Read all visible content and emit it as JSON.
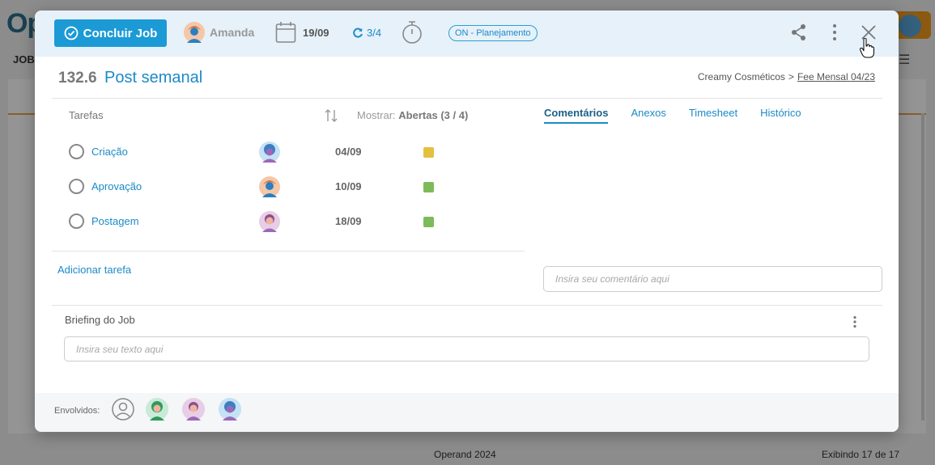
{
  "background": {
    "logo": "Op",
    "jobs_label": "JOBS",
    "footer_left": "Operand 2024",
    "footer_right": "Exibindo 17 de 17"
  },
  "header": {
    "conclude_label": "Concluir Job",
    "owner_name": "Amanda",
    "due_date": "19/09",
    "recurrence": "3/4",
    "status": "ON - Planejamento"
  },
  "job": {
    "id": "132.6",
    "title": "Post semanal",
    "client": "Creamy Cosméticos",
    "separator": ">",
    "contract": "Fee Mensal 04/23"
  },
  "tasks": {
    "header": "Tarefas",
    "show_label": "Mostrar:",
    "show_value": "Abertas (3 / 4)",
    "add_label": "Adicionar tarefa",
    "items": [
      {
        "name": "Criação",
        "date": "04/09",
        "color": "#e5c040",
        "avatar": "blue"
      },
      {
        "name": "Aprovação",
        "date": "10/09",
        "color": "#7dbb5a",
        "avatar": "orange"
      },
      {
        "name": "Postagem",
        "date": "18/09",
        "color": "#7dbb5a",
        "avatar": "purple"
      }
    ]
  },
  "side_tabs": {
    "comments": "Comentários",
    "attachments": "Anexos",
    "timesheet": "Timesheet",
    "history": "Histórico"
  },
  "comment": {
    "placeholder": "Insira seu comentário aqui"
  },
  "briefing": {
    "title": "Briefing do Job",
    "placeholder": "Insira seu texto aqui"
  },
  "involved": {
    "label": "Envolvidos:"
  },
  "colors": {
    "accent": "#1b9ad6",
    "link": "#1b8ac7",
    "header_bg": "#e6f1f9"
  }
}
